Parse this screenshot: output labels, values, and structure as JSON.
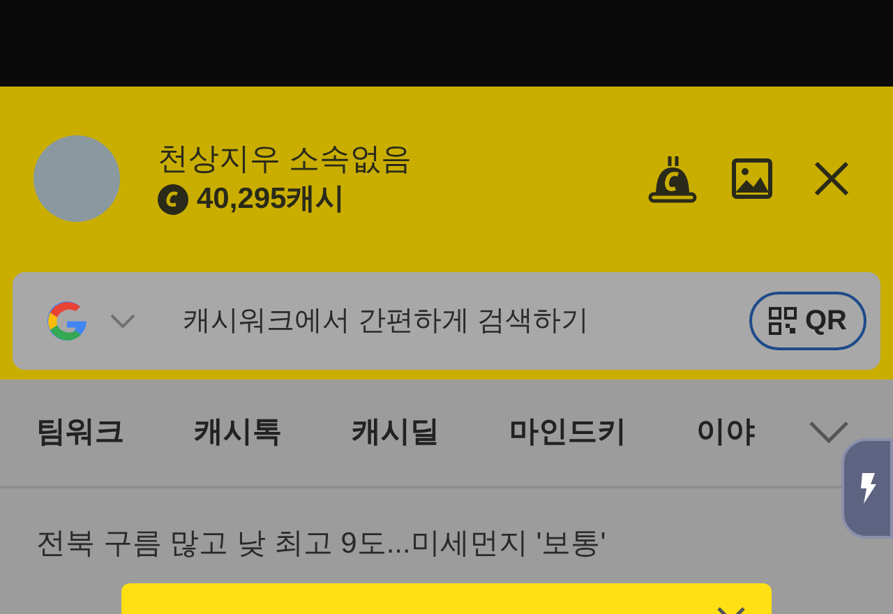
{
  "profile": {
    "name": "천상지우 소속없음",
    "cash": "40,295캐시"
  },
  "search": {
    "placeholder": "캐시워크에서 간편하게 검색하기",
    "qr_label": "QR"
  },
  "tabs": [
    {
      "label": "팀워크"
    },
    {
      "label": "캐시톡"
    },
    {
      "label": "캐시딜"
    },
    {
      "label": "마인드키"
    },
    {
      "label": "이야"
    }
  ],
  "headline": "전북 구름 많고 낮 최고 9도...미세먼지 '보통'"
}
